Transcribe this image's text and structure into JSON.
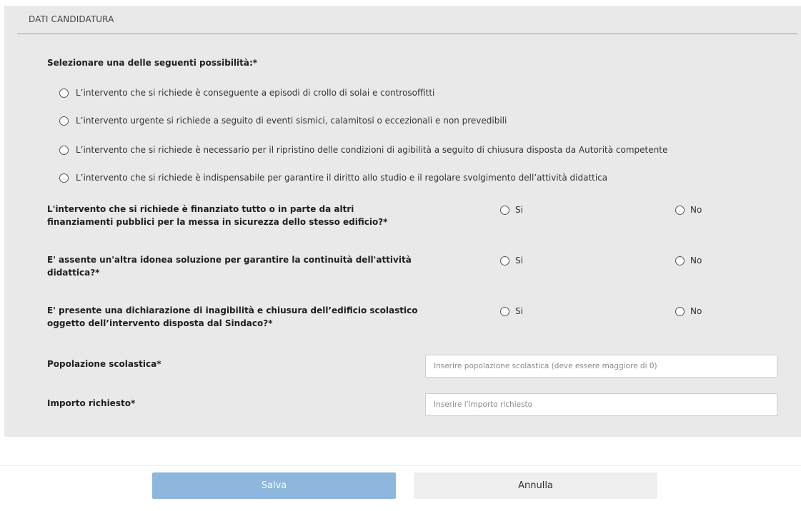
{
  "section": {
    "title": "DATI CANDIDATURA"
  },
  "selection": {
    "title": "Selezionare una delle seguenti possibilità:*",
    "options": [
      "L’intervento che si richiede è conseguente a episodi di crollo di solai e controsoffitti",
      "L’intervento urgente si richiede a seguito di eventi sismici, calamitosi o eccezionali e non prevedibili",
      "L’intervento che si richiede è necessario per il ripristino delle condizioni di agibilità a seguito di chiusura disposta da Autorità competente",
      "L’intervento che si richiede è indispensabile per garantire il diritto allo studio e il regolare svolgimento dell’attività didattica"
    ]
  },
  "yes_no_questions": [
    {
      "text": "L'intervento che si richiede è finanziato tutto o in parte da altri finanziamenti pubblici per la messa in sicurezza dello stesso edificio?*",
      "yes_label": "Si",
      "no_label": "No"
    },
    {
      "text": "E' assente un'altra idonea soluzione per garantire la continuità dell'attività didattica?*",
      "yes_label": "Si",
      "no_label": "No"
    },
    {
      "text": "E' presente una dichiarazione di inagibilità e chiusura dell’edificio scolastico oggetto dell’intervento disposta dal Sindaco?*",
      "yes_label": "Si",
      "no_label": "No"
    }
  ],
  "fields": {
    "popolazione": {
      "label": "Popolazione scolastica*",
      "placeholder": "Inserire popolazione scolastica (deve essere maggiore di 0)",
      "value": ""
    },
    "importo": {
      "label": "Importo richiesto*",
      "placeholder": "Inserire l'importo richiesto",
      "value": ""
    }
  },
  "actions": {
    "save_label": "Salva",
    "cancel_label": "Annulla"
  },
  "colors": {
    "panel_background": "#e9e9e9",
    "header_rule": "#7fa4cc",
    "save_button": "#8db7dd",
    "cancel_button": "#efefef"
  }
}
